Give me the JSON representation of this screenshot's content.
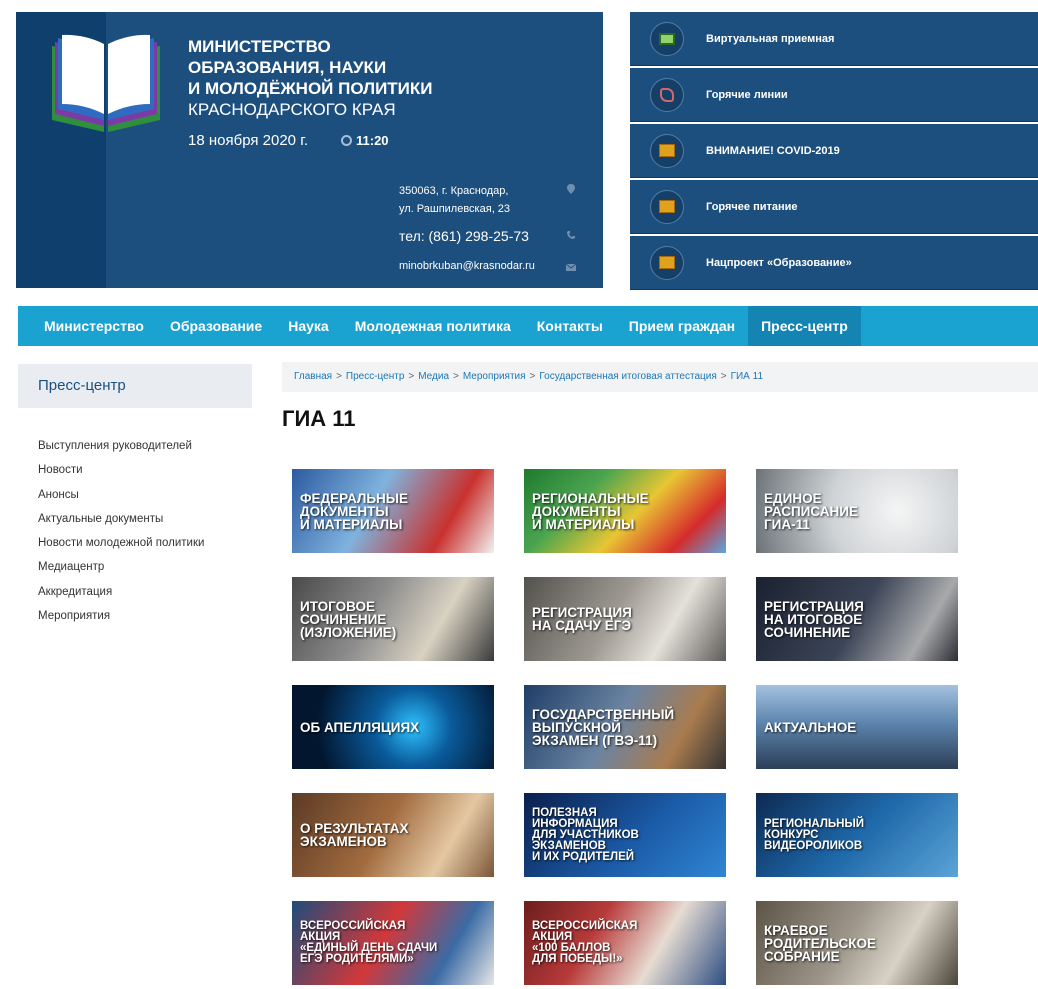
{
  "header": {
    "ministry_line1": "МИНИСТЕРСТВО",
    "ministry_line2": "ОБРАЗОВАНИЯ, НАУКИ",
    "ministry_line3": "И МОЛОДЁЖНОЙ ПОЛИТИКИ",
    "ministry_line4": "КРАСНОДАРСКОГО КРАЯ",
    "date": "18 ноября 2020 г.",
    "time": "11:20",
    "address_line1": "350063, г. Краснодар,",
    "address_line2": "ул. Рашпилевская, 23",
    "phone": "тел: (861) 298-25-73",
    "email": "minobrkuban@krasnodar.ru"
  },
  "quick_links": [
    {
      "label": "Виртуальная приемная",
      "icon": "computer-icon"
    },
    {
      "label": "Горячие линии",
      "icon": "phone-icon"
    },
    {
      "label": "ВНИМАНИЕ! COVID-2019",
      "icon": "document-icon"
    },
    {
      "label": "Горячее питание",
      "icon": "document-icon"
    },
    {
      "label": "Нацпроект «Образование»",
      "icon": "document-icon"
    }
  ],
  "nav": {
    "items": [
      "Министерство",
      "Образование",
      "Наука",
      "Молодежная политика",
      "Контакты",
      "Прием граждан",
      "Пресс-центр"
    ],
    "active": "Пресс-центр"
  },
  "sidebar": {
    "title": "Пресс-центр",
    "items": [
      "Выступления руководителей",
      "Новости",
      "Анонсы",
      "Актуальные документы",
      "Новости молодежной политики",
      "Медиацентр",
      "Аккредитация",
      "Мероприятия"
    ]
  },
  "breadcrumb": [
    "Главная",
    "Пресс-центр",
    "Медиа",
    "Мероприятия",
    "Государственная итоговая аттестация",
    "ГИА 11"
  ],
  "page_title": "ГИА 11",
  "tiles": [
    "ФЕДЕРАЛЬНЫЕ\nДОКУМЕНТЫ\nИ МАТЕРИАЛЫ",
    "РЕГИОНАЛЬНЫЕ\nДОКУМЕНТЫ\nИ МАТЕРИАЛЫ",
    "ЕДИНОЕ\nРАСПИСАНИЕ\nГИА-11",
    "ИТОГОВОЕ\nСОЧИНЕНИЕ\n(ИЗЛОЖЕНИЕ)",
    "РЕГИСТРАЦИЯ\nНА СДАЧУ ЕГЭ",
    "РЕГИСТРАЦИЯ\nНА ИТОГОВОЕ\nСОЧИНЕНИЕ",
    "ОБ АПЕЛЛЯЦИЯХ",
    "ГОСУДАРСТВЕННЫЙ\nВЫПУСКНОЙ\nЭКЗАМЕН (ГВЭ-11)",
    "АКТУАЛЬНОЕ",
    "О РЕЗУЛЬТАТАХ\nЭКЗАМЕНОВ",
    "ПОЛЕЗНАЯ\nИНФОРМАЦИЯ\nДЛЯ УЧАСТНИКОВ\nЭКЗАМЕНОВ\nИ ИХ РОДИТЕЛЕЙ",
    "РЕГИОНАЛЬНЫЙ\nКОНКУРС\nВИДЕОРОЛИКОВ",
    "ВСЕРОССИЙСКАЯ\nАКЦИЯ\n«ЕДИНЫЙ ДЕНЬ СДАЧИ\nЕГЭ РОДИТЕЛЯМИ»",
    "ВСЕРОССИЙСКАЯ\nАКЦИЯ\n«100 БАЛЛОВ\nДЛЯ ПОБЕДЫ!»",
    "КРАЕВОЕ\nРОДИТЕЛЬСКОЕ\nСОБРАНИЕ"
  ]
}
